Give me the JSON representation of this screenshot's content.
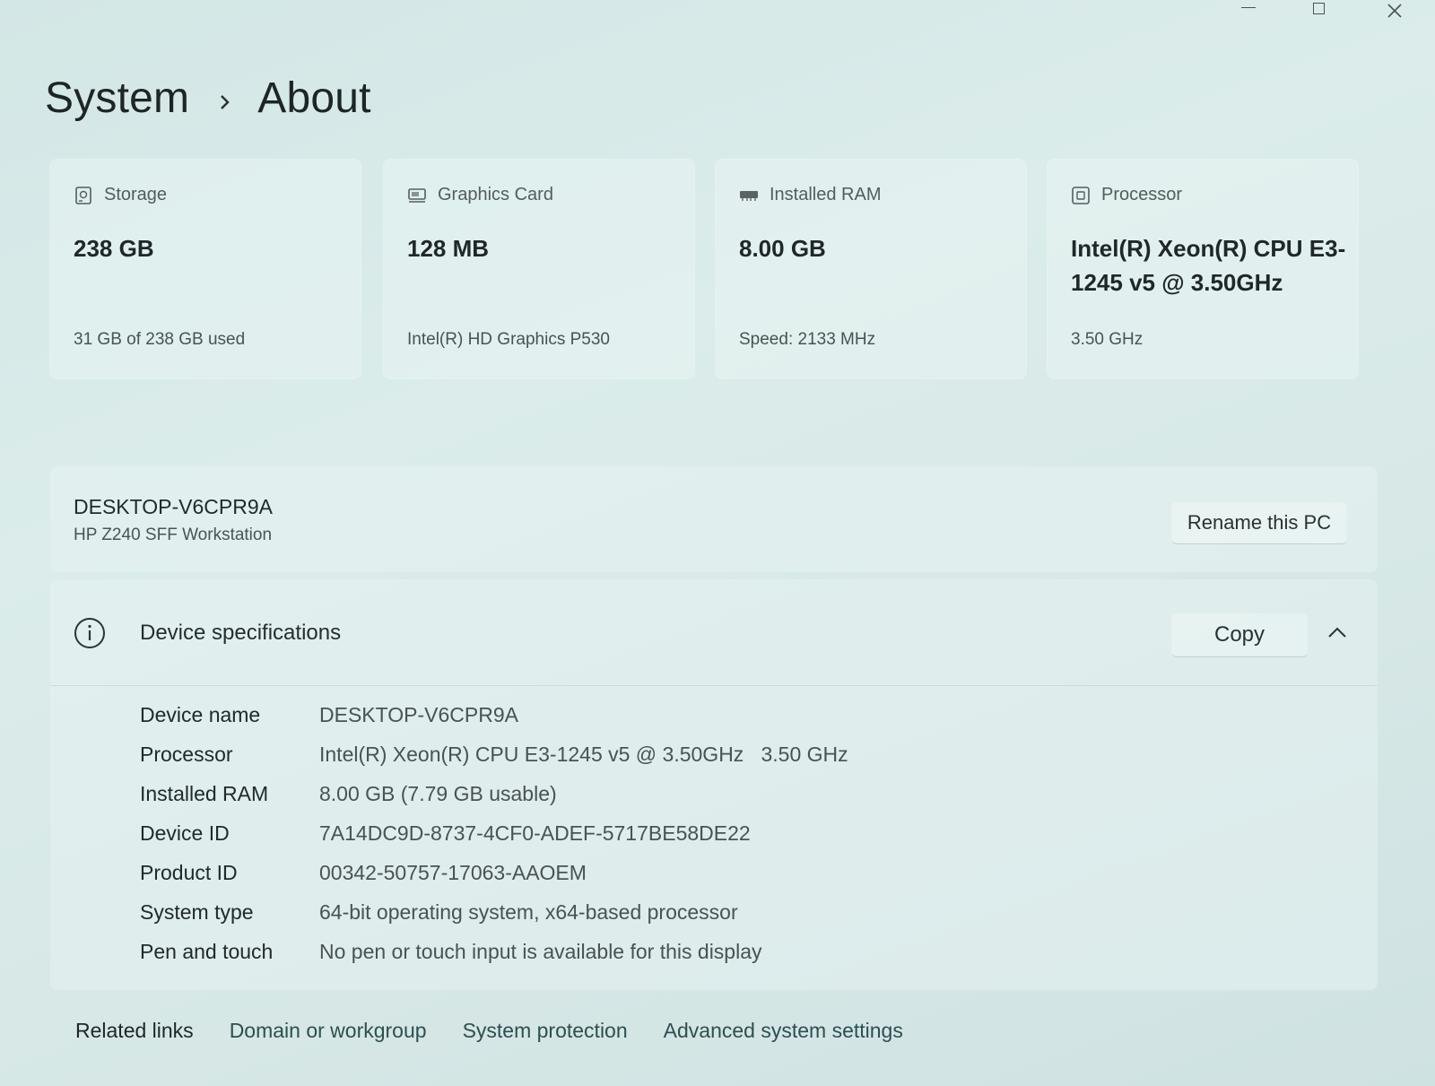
{
  "window": {
    "controls": [
      "minimize",
      "maximize",
      "close"
    ]
  },
  "breadcrumb": {
    "parent": "System",
    "separator_icon": "chevron-right-icon",
    "current": "About"
  },
  "cards": [
    {
      "icon": "storage-icon",
      "title": "Storage",
      "value": "238 GB",
      "detail": "31 GB of 238 GB used"
    },
    {
      "icon": "graphics-card-icon",
      "title": "Graphics Card",
      "value": "128 MB",
      "detail": "Intel(R) HD Graphics P530"
    },
    {
      "icon": "ram-icon",
      "title": "Installed RAM",
      "value": "8.00 GB",
      "detail": "Speed: 2133 MHz"
    },
    {
      "icon": "processor-icon",
      "title": "Processor",
      "value": "Intel(R) Xeon(R) CPU E3-1245 v5 @ 3.50GHz",
      "detail": "3.50 GHz"
    }
  ],
  "device": {
    "name": "DESKTOP-V6CPR9A",
    "model": "HP Z240 SFF Workstation",
    "rename_label": "Rename this PC"
  },
  "specs": {
    "title": "Device specifications",
    "copy_label": "Copy",
    "rows": [
      {
        "label": "Device name",
        "value": "DESKTOP-V6CPR9A"
      },
      {
        "label": "Processor",
        "value": "Intel(R) Xeon(R) CPU E3-1245 v5 @ 3.50GHz   3.50 GHz"
      },
      {
        "label": "Installed RAM",
        "value": "8.00 GB (7.79 GB usable)"
      },
      {
        "label": "Device ID",
        "value": "7A14DC9D-8737-4CF0-ADEF-5717BE58DE22"
      },
      {
        "label": "Product ID",
        "value": "00342-50757-17063-AAOEM"
      },
      {
        "label": "System type",
        "value": "64-bit operating system, x64-based processor"
      },
      {
        "label": "Pen and touch",
        "value": "No pen or touch input is available for this display"
      }
    ]
  },
  "related": {
    "label": "Related links",
    "links": [
      "Domain or workgroup",
      "System protection",
      "Advanced system settings"
    ]
  }
}
